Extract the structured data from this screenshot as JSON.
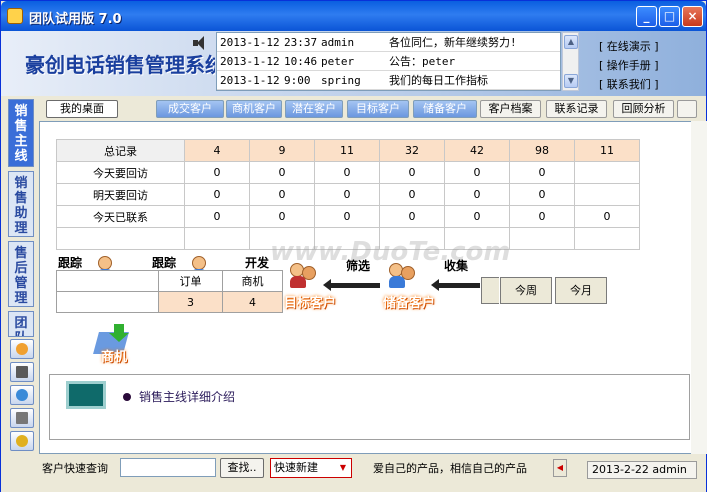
{
  "window": {
    "title": "团队试用版 7.0",
    "minimize": "_",
    "maximize": "□",
    "close": "×"
  },
  "brand": "豪创电话销售管理系统",
  "notices": [
    {
      "date": "2013-1-12",
      "time": "23:37",
      "user": "admin",
      "message": "各位同仁，新年继续努力!"
    },
    {
      "date": "2013-1-12",
      "time": "10:46",
      "user": "peter",
      "message": "公告：peter"
    },
    {
      "date": "2013-1-12",
      "time": "9:00",
      "user": "spring",
      "message": "我们的每日工作指标"
    }
  ],
  "links": [
    "[ 在线演示 ]",
    "[ 操作手册 ]",
    "[ 联系我们 ]"
  ],
  "sidebar": {
    "tabs": [
      "销售主线",
      "销售助理",
      "售后管理",
      "团队"
    ],
    "collapse": "<<"
  },
  "toptabs": {
    "mine": "我的桌面",
    "items": [
      "成交客户",
      "商机客户",
      "潜在客户",
      "目标客户",
      "储备客户",
      "客户档案",
      "联系记录",
      "回顾分析"
    ]
  },
  "stats": {
    "rows": [
      {
        "label": "总记录",
        "values": [
          "4",
          "9",
          "11",
          "32",
          "42",
          "98",
          "11"
        ]
      },
      {
        "label": "今天要回访",
        "values": [
          "0",
          "0",
          "0",
          "0",
          "0",
          "0",
          ""
        ]
      },
      {
        "label": "明天要回访",
        "values": [
          "0",
          "0",
          "0",
          "0",
          "0",
          "0",
          ""
        ]
      },
      {
        "label": "今天已联系",
        "values": [
          "0",
          "0",
          "0",
          "0",
          "0",
          "0",
          "0"
        ]
      },
      {
        "label": "",
        "values": [
          "",
          "",
          "",
          "",
          "",
          "",
          ""
        ]
      }
    ]
  },
  "watermark": "www.DuoTe.com",
  "flow": {
    "labels": [
      "跟踪",
      "跟踪",
      "开发",
      "筛选",
      "收集"
    ],
    "target": "目标客户",
    "reserve": "储备客户",
    "opportunity": "商机"
  },
  "mini": {
    "headers": [
      "订单",
      "商机"
    ],
    "values": [
      "3",
      "4"
    ]
  },
  "periods": [
    "今周",
    "今月"
  ],
  "description": "销售主线详细介绍",
  "status": {
    "search_label": "客户快速查询",
    "search_value": "",
    "find_button": "查找..",
    "select_value": "快速新建",
    "slogan": "爱自己的产品，相信自己的产品",
    "date_user": "2013-2-22 admin"
  }
}
